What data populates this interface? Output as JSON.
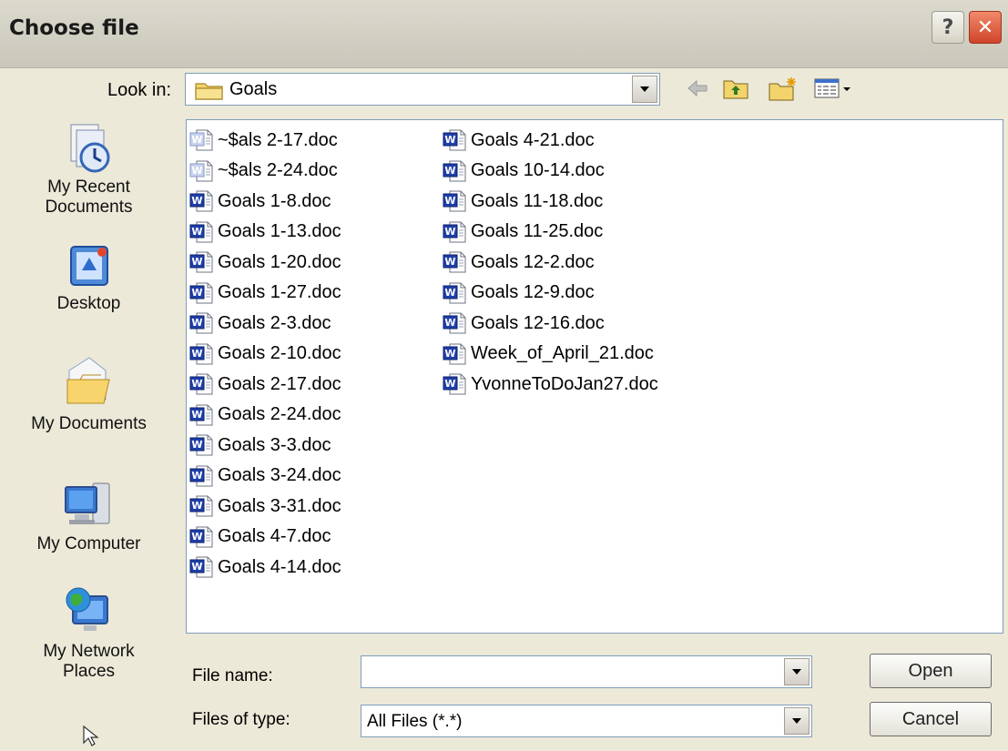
{
  "window": {
    "title": "Choose file"
  },
  "toolbar": {
    "look_in_label": "Look in:",
    "look_in_value": "Goals"
  },
  "places": [
    {
      "label": "My Recent\nDocuments",
      "icon": "recent-documents-icon"
    },
    {
      "label": "Desktop",
      "icon": "desktop-icon"
    },
    {
      "label": "My Documents",
      "icon": "my-documents-icon"
    },
    {
      "label": "My Computer",
      "icon": "my-computer-icon"
    },
    {
      "label": "My Network\nPlaces",
      "icon": "network-places-icon"
    }
  ],
  "files": {
    "column1": [
      {
        "name": "~$als 2-17.doc",
        "temp": true
      },
      {
        "name": "~$als 2-24.doc",
        "temp": true
      },
      {
        "name": "Goals 1-8.doc"
      },
      {
        "name": "Goals 1-13.doc"
      },
      {
        "name": "Goals 1-20.doc"
      },
      {
        "name": "Goals 1-27.doc"
      },
      {
        "name": "Goals 2-3.doc"
      },
      {
        "name": "Goals 2-10.doc"
      },
      {
        "name": "Goals 2-17.doc"
      },
      {
        "name": "Goals 2-24.doc"
      },
      {
        "name": "Goals 3-3.doc"
      },
      {
        "name": "Goals 3-24.doc"
      },
      {
        "name": "Goals 3-31.doc"
      },
      {
        "name": "Goals 4-7.doc"
      },
      {
        "name": "Goals 4-14.doc"
      }
    ],
    "column2": [
      {
        "name": "Goals 4-21.doc"
      },
      {
        "name": "Goals 10-14.doc"
      },
      {
        "name": "Goals 11-18.doc"
      },
      {
        "name": "Goals 11-25.doc"
      },
      {
        "name": "Goals 12-2.doc"
      },
      {
        "name": "Goals 12-9.doc"
      },
      {
        "name": "Goals 12-16.doc"
      },
      {
        "name": "Week_of_April_21.doc"
      },
      {
        "name": "YvonneToDoJan27.doc"
      }
    ]
  },
  "form": {
    "file_name_label": "File name:",
    "file_name_value": "",
    "file_type_label": "Files of type:",
    "file_type_value": "All Files (*.*)"
  },
  "buttons": {
    "open": "Open",
    "cancel": "Cancel",
    "help": "?",
    "close": "✕"
  },
  "colors": {
    "word_blue": "#1f3fa8",
    "field_border": "#7f9db9",
    "dialog_bg": "#ece9d8"
  }
}
